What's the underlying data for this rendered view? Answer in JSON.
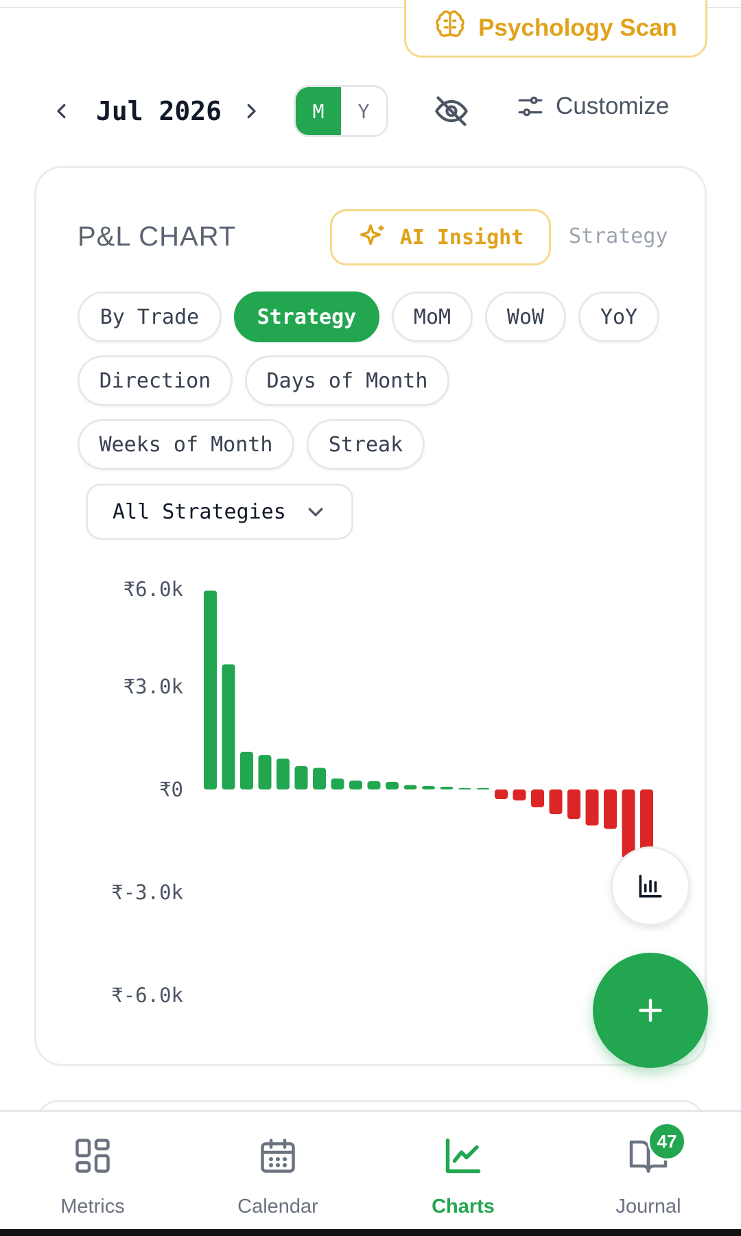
{
  "header": {
    "psychology_label": "Psychology Scan",
    "month_label": "Jul 2026",
    "period_toggle": {
      "options": [
        "M",
        "Y"
      ],
      "selected": "M"
    },
    "customize_label": "Customize"
  },
  "pnl_card": {
    "title": "P&L CHART",
    "ai_insight_label": "AI Insight",
    "mode_label": "Strategy",
    "chips": [
      "By Trade",
      "Strategy",
      "MoM",
      "WoW",
      "YoY",
      "Direction",
      "Days of Month",
      "Weeks of Month",
      "Streak"
    ],
    "active_chip": "Strategy",
    "strategy_filter": "All Strategies"
  },
  "chart_data": {
    "type": "bar",
    "y_tick_labels": [
      "₹6.0k",
      "₹3.0k",
      "₹0",
      "₹-3.0k",
      "₹-6.0k"
    ],
    "ylim": [
      -6000,
      6000
    ],
    "values": [
      5800,
      3650,
      1100,
      1000,
      900,
      680,
      630,
      320,
      260,
      240,
      220,
      130,
      100,
      80,
      40,
      30,
      -280,
      -320,
      -520,
      -720,
      -860,
      -1050,
      -1150,
      -2000,
      -2050
    ],
    "colors": {
      "positive": "#22a650",
      "negative": "#dc2626"
    }
  },
  "bottom_nav": {
    "items": [
      {
        "label": "Metrics",
        "icon": "grid-icon"
      },
      {
        "label": "Calendar",
        "icon": "calendar-icon"
      },
      {
        "label": "Charts",
        "icon": "chart-line-icon"
      },
      {
        "label": "Journal",
        "icon": "book-icon"
      }
    ],
    "active": "Charts",
    "journal_badge": "47"
  }
}
